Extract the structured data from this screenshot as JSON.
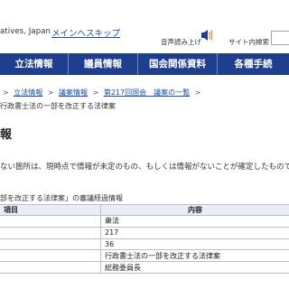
{
  "header": {
    "site_name": "atives, Japan",
    "skip_link": "メインへスキップ",
    "audio_label": "音声読み上げ",
    "search_label": "サイト内検索"
  },
  "nav": {
    "items": [
      {
        "label": "立法情報"
      },
      {
        "label": "議員情報"
      },
      {
        "label": "国会関係資料"
      },
      {
        "label": "各種手続"
      }
    ]
  },
  "breadcrumb": {
    "items": [
      {
        "label": "立法情報"
      },
      {
        "label": "議案情報"
      },
      {
        "label": "第217回国会　議案の一覧"
      }
    ],
    "separator": ">",
    "current": "行政書士法の一部を改正する法律案"
  },
  "page": {
    "heading": "報",
    "notice": "ない箇所は、現時点で情報が未定のもの、もしくは情報がないことが確定したものです",
    "table_caption": "部を改正する法律案」の審議経過情報"
  },
  "table": {
    "headers": [
      "項目",
      "内容"
    ],
    "rows": [
      [
        "",
        "衆法"
      ],
      [
        "",
        "217"
      ],
      [
        "",
        "36"
      ],
      [
        "",
        "行政書士法の一部を改正する法律案"
      ],
      [
        "",
        "総務委員長"
      ]
    ]
  },
  "colors": {
    "nav_bg": "#1f3f8e",
    "link": "#1a4fb0",
    "table_header_bg": "#e9edf5"
  },
  "icons": [
    "speaker-icon"
  ]
}
